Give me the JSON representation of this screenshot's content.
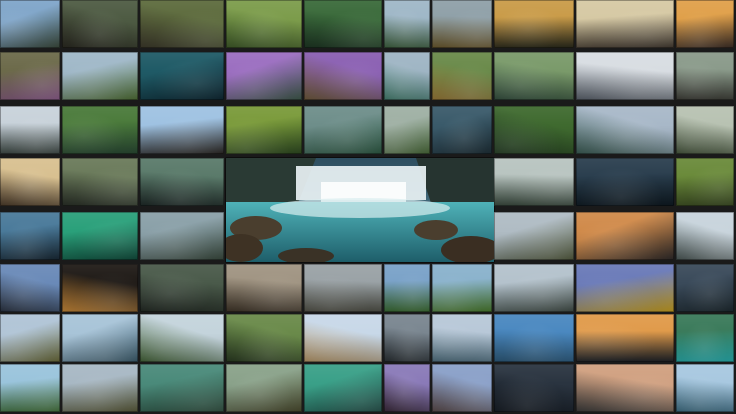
{
  "scene": {
    "description_free": true
  },
  "tiles": [
    {
      "name": "tile-mountain-lake",
      "c1": "#7fa5c9",
      "c2": "#3b4a3c"
    },
    {
      "name": "tile-forest-path",
      "c1": "#4e5b43",
      "c2": "#2b2a22"
    },
    {
      "name": "tile-boardwalk-forest",
      "c1": "#5d6b3d",
      "c2": "#3d3a2c"
    },
    {
      "name": "tile-green-valley",
      "c1": "#7c9c4b",
      "c2": "#3f5a2a"
    },
    {
      "name": "tile-mossy-stream",
      "c1": "#3a6a3a",
      "c2": "#1e3624"
    },
    {
      "name": "tile-river-valley",
      "c1": "#9fb7c7",
      "c2": "#3f6140"
    },
    {
      "name": "tile-autumn-hills",
      "c1": "#8fa0a8",
      "c2": "#6c5a2f"
    },
    {
      "name": "tile-forest-sunburst",
      "c1": "#c99b48",
      "c2": "#2a2a1c"
    },
    {
      "name": "tile-lantern-ruins",
      "c1": "#d6c9a4",
      "c2": "#3b3229"
    },
    {
      "name": "tile-sunset-coast",
      "c1": "#e0a04a",
      "c2": "#3d2f28"
    },
    {
      "name": "tile-purple-meadow",
      "c1": "#6c6a4a",
      "c2": "#8a5a8a"
    },
    {
      "name": "tile-green-mountains",
      "c1": "#a0b8c8",
      "c2": "#4f6e35"
    },
    {
      "name": "tile-underwater-deep",
      "c1": "#1f5a66",
      "c2": "#0c2530"
    },
    {
      "name": "tile-lavender-stream",
      "c1": "#9b6ec0",
      "c2": "#3e5a4a"
    },
    {
      "name": "tile-lavender-path",
      "c1": "#8a5fb2",
      "c2": "#6e5a3a"
    },
    {
      "name": "tile-fjord-river",
      "c1": "#9fb5c4",
      "c2": "#3f7a6a"
    },
    {
      "name": "tile-golden-cliffs",
      "c1": "#6a8a4a",
      "c2": "#9a7a3a"
    },
    {
      "name": "tile-waterfall-valley",
      "c1": "#7a9a6a",
      "c2": "#2f4a3a"
    },
    {
      "name": "tile-snowy-peaks",
      "c1": "#d8dde2",
      "c2": "#59606a"
    },
    {
      "name": "tile-rocky-waterfall",
      "c1": "#8a9a8a",
      "c2": "#3a3a34"
    },
    {
      "name": "tile-cloudy-lake",
      "c1": "#c8d2da",
      "c2": "#3f4a46"
    },
    {
      "name": "tile-jungle-falls",
      "c1": "#4a7a3a",
      "c2": "#2a4a34"
    },
    {
      "name": "tile-pagoda",
      "c1": "#9fc2e2",
      "c2": "#2a2622"
    },
    {
      "name": "tile-bamboo-grove",
      "c1": "#7a9a3a",
      "c2": "#2e4a22"
    },
    {
      "name": "tile-green-fjord",
      "c1": "#6e8e8a",
      "c2": "#2e5a44"
    },
    {
      "name": "tile-misty-hills",
      "c1": "#9fb0a4",
      "c2": "#4a6a3a"
    },
    {
      "name": "tile-rapids",
      "c1": "#3a5a6a",
      "c2": "#1f3038"
    },
    {
      "name": "tile-green-canyon",
      "c1": "#3f6a2f",
      "c2": "#203820"
    },
    {
      "name": "tile-alpine-lake",
      "c1": "#a8b8c8",
      "c2": "#3a5a52"
    },
    {
      "name": "tile-twin-falls",
      "c1": "#b8c2b2",
      "c2": "#3a4a30"
    },
    {
      "name": "tile-golden-canyon",
      "c1": "#d8c090",
      "c2": "#4a3a2a"
    },
    {
      "name": "tile-cascade-forest",
      "c1": "#6a7a5a",
      "c2": "#2a3028"
    },
    {
      "name": "tile-dark-river",
      "c1": "#5a7a6a",
      "c2": "#1f2a28"
    },
    {
      "name": "tile-twisted-tree",
      "c1": "#b8c4c0",
      "c2": "#3a4a3e"
    },
    {
      "name": "tile-kayak-falls",
      "c1": "#2a3e4e",
      "c2": "#0f1a22"
    },
    {
      "name": "tile-yellow-flowers",
      "c1": "#6a8a3a",
      "c2": "#3a4a22"
    },
    {
      "name": "tile-blue-falls",
      "c1": "#4a7a9a",
      "c2": "#1a2a36"
    },
    {
      "name": "tile-green-diver",
      "c1": "#2aa07a",
      "c2": "#0f4a3a"
    },
    {
      "name": "tile-lakeside-cliffs",
      "c1": "#8aa0a8",
      "c2": "#3a4a3e"
    },
    {
      "name": "tile-tree-riverbank",
      "c1": "#b0bcc4",
      "c2": "#4a5234"
    },
    {
      "name": "tile-sunset-lake",
      "c1": "#d08a4a",
      "c2": "#2e2a2a"
    },
    {
      "name": "tile-misty-waterfall",
      "c1": "#c8d4dc",
      "c2": "#4a5654"
    },
    {
      "name": "tile-rocky-shore",
      "c1": "#6a8ab8",
      "c2": "#2a3240"
    },
    {
      "name": "tile-cave-glow",
      "c1": "#1f1a16",
      "c2": "#c98a3a"
    },
    {
      "name": "tile-mossy-rocks",
      "c1": "#4a5a4a",
      "c2": "#232a24"
    },
    {
      "name": "tile-desert-canyon",
      "c1": "#a09482",
      "c2": "#3e3428"
    },
    {
      "name": "tile-lone-tree",
      "c1": "#9aa2a6",
      "c2": "#4a4a40"
    },
    {
      "name": "tile-sunny-valley",
      "c1": "#7aa2c8",
      "c2": "#3a6a30"
    },
    {
      "name": "tile-green-hills",
      "c1": "#8ab2cc",
      "c2": "#4a7a2e"
    },
    {
      "name": "tile-rocky-coast",
      "c1": "#b4c2cc",
      "c2": "#3e4a44"
    },
    {
      "name": "tile-flower-field",
      "c1": "#6a7ab8",
      "c2": "#c8a020"
    },
    {
      "name": "tile-boulder-river",
      "c1": "#3a4a5a",
      "c2": "#1e2a30"
    },
    {
      "name": "tile-grassy-plains",
      "c1": "#b0c4d6",
      "c2": "#6a6a3a"
    },
    {
      "name": "tile-blue-lake",
      "c1": "#a8c4d8",
      "c2": "#3a5a6a"
    },
    {
      "name": "tile-tropical-trees",
      "c1": "#c4d4dc",
      "c2": "#3a5a2e"
    },
    {
      "name": "tile-hillside-forest",
      "c1": "#6a8a4a",
      "c2": "#2a3a22"
    },
    {
      "name": "tile-sand-dunes",
      "c1": "#c8d8e8",
      "c2": "#b09060"
    },
    {
      "name": "tile-dark-mountain-lake",
      "c1": "#7a8690",
      "c2": "#2a3034"
    },
    {
      "name": "tile-snowy-lake",
      "c1": "#b8c8d8",
      "c2": "#4a6a7a"
    },
    {
      "name": "tile-ocean-shore",
      "c1": "#4a88c0",
      "c2": "#2e5a7a"
    },
    {
      "name": "tile-sunset-mountains",
      "c1": "#e09a4a",
      "c2": "#1e2228"
    },
    {
      "name": "tile-turquoise-pool",
      "c1": "#3a7a5a",
      "c2": "#2ab0b0"
    },
    {
      "name": "tile-tropical-bay",
      "c1": "#9ac4dc",
      "c2": "#3a6a30"
    },
    {
      "name": "tile-mountain-road",
      "c1": "#a8b8c4",
      "c2": "#5a5a3a"
    },
    {
      "name": "tile-turquoise-stream",
      "c1": "#4a8a7a",
      "c2": "#2a4a3a"
    },
    {
      "name": "tile-riverside-trees",
      "c1": "#8aa28a",
      "c2": "#4a4a2e"
    },
    {
      "name": "tile-green-lagoon",
      "c1": "#3aa088",
      "c2": "#1f4a44"
    },
    {
      "name": "tile-rocky-sunset",
      "c1": "#8a7ab8",
      "c2": "#3a2a3a"
    },
    {
      "name": "tile-pink-sky-lake",
      "c1": "#8aa0c8",
      "c2": "#5a4a4a"
    },
    {
      "name": "tile-night-coast",
      "c1": "#2a3440",
      "c2": "#141a22"
    },
    {
      "name": "tile-sunset-shore",
      "c1": "#d0a080",
      "c2": "#3a3a3a"
    },
    {
      "name": "tile-calm-lake",
      "c1": "#a8c8e0",
      "c2": "#3a6a80"
    }
  ],
  "feature": {
    "name": "feature-waterfall",
    "sky": "#3e6478",
    "falls": "#e8f0f2",
    "water": "#2f8c96",
    "rock": "#3a3428"
  }
}
